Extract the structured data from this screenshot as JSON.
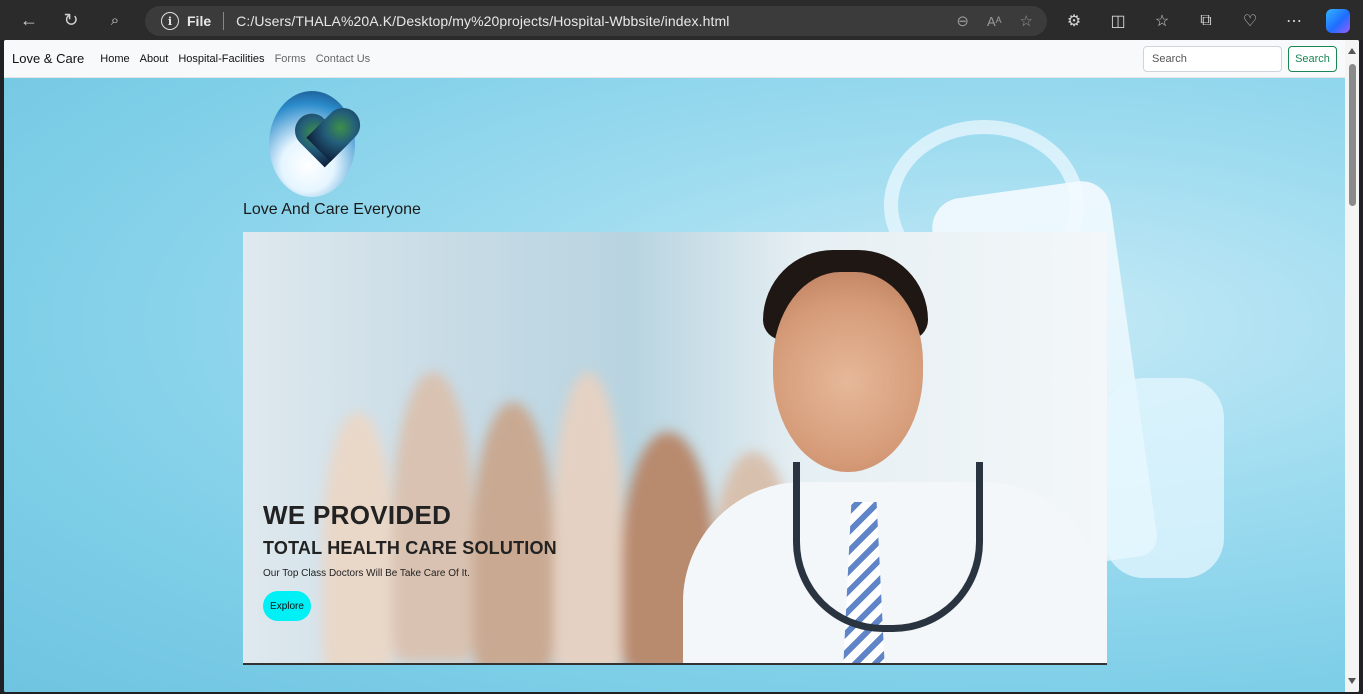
{
  "browser": {
    "address_label": "File",
    "url": "C:/Users/THALA%20A.K/Desktop/my%20projects/Hospital-Wbbsite/index.html",
    "icons": [
      "back-icon",
      "refresh-icon",
      "search-icon",
      "info-icon",
      "zoom-out-icon",
      "read-aloud-icon",
      "favorite-star-icon",
      "extensions-icon",
      "split-screen-icon",
      "favorites-icon",
      "collections-icon",
      "browser-essentials-icon",
      "more-icon",
      "copilot-icon"
    ]
  },
  "navbar": {
    "brand": "Love & Care",
    "links": [
      "Home",
      "About",
      "Hospital-Facilities",
      "Forms",
      "Contact Us"
    ],
    "search_placeholder": "Search",
    "search_button": "Search"
  },
  "header": {
    "tagline": "Love And Care Everyone"
  },
  "carousel": {
    "title": "WE PROVIDED",
    "subtitle": "TOTAL HEALTH CARE SOLUTION",
    "text": "Our Top Class Doctors Will Be Take Care Of It.",
    "button": "Explore"
  },
  "colors": {
    "accent_green": "#198754",
    "explore_button": "#00f0f5",
    "page_background": "#8fd6ee"
  }
}
